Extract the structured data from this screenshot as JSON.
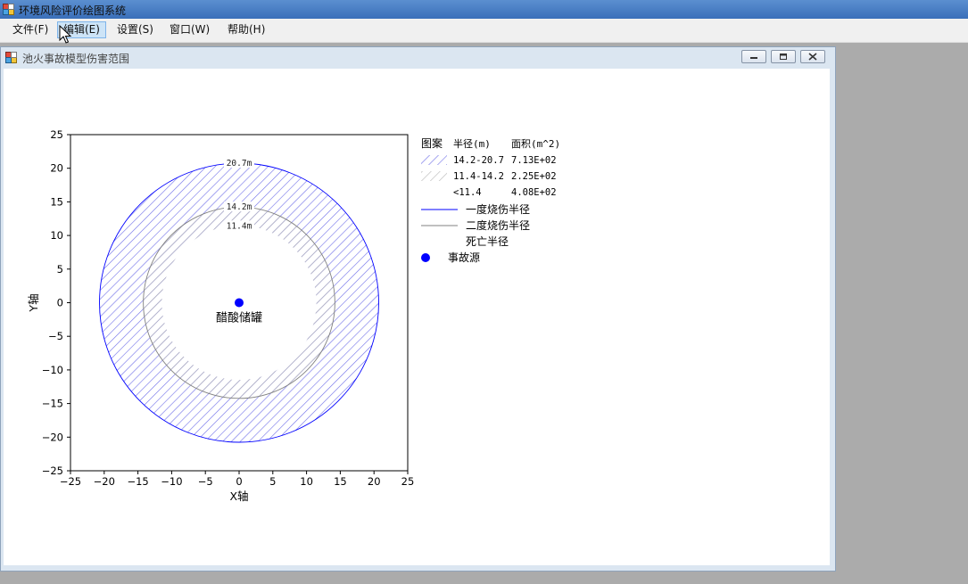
{
  "app": {
    "title": "环境风险评价绘图系统",
    "icon": "app-icon"
  },
  "menu": {
    "items": [
      {
        "label": "文件(F)"
      },
      {
        "label": "编辑(E)"
      },
      {
        "label": "设置(S)"
      },
      {
        "label": "窗口(W)"
      },
      {
        "label": "帮助(H)"
      }
    ],
    "active_index": 1
  },
  "child_window": {
    "title": "池火事故模型伤害范围",
    "icon": "child-window-icon",
    "buttons": [
      "minimize",
      "restore",
      "close"
    ]
  },
  "chart_data": {
    "type": "scatter",
    "subtype": "concentric-circle-damage-zones",
    "xlabel": "X轴",
    "ylabel": "Y轴",
    "xlim": [
      -25,
      25
    ],
    "ylim": [
      -25,
      25
    ],
    "xticks": [
      -25,
      -20,
      -15,
      -10,
      -5,
      0,
      5,
      10,
      15,
      20,
      25
    ],
    "yticks": [
      25,
      20,
      15,
      10,
      5,
      0,
      -5,
      -10,
      -15,
      -20,
      -25
    ],
    "grid": false,
    "legend_position": "right",
    "circles": [
      {
        "name": "一度烧伤半径",
        "radius": 20.7,
        "label": "20.7m",
        "stroke": "#0000ff",
        "hatch": "#6f6fe8"
      },
      {
        "name": "二度烧伤半径",
        "radius": 14.2,
        "label": "14.2m",
        "stroke": "#808080",
        "hatch": "#b4b4b4"
      },
      {
        "name": "死亡半径",
        "radius": 11.4,
        "label": "11.4m",
        "stroke": "#ffffff",
        "hatch": "none"
      }
    ],
    "source": {
      "name": "醋酸储罐",
      "x": 0,
      "y": 0,
      "color": "#0000ff"
    },
    "legend": {
      "headers": [
        "图案",
        "半径(m)",
        "面积(m^2)"
      ],
      "rows": [
        {
          "pattern": "blue-hatch",
          "radius": "14.2-20.7",
          "area": "7.13E+02"
        },
        {
          "pattern": "gray-hatch",
          "radius": "11.4-14.2",
          "area": "2.25E+02"
        },
        {
          "pattern": "none",
          "radius": "<11.4",
          "area": "4.08E+02"
        }
      ],
      "lines": [
        {
          "label": "一度烧伤半径",
          "color": "#0000ff"
        },
        {
          "label": "二度烧伤半径",
          "color": "#808080"
        },
        {
          "label": "死亡半径",
          "color": "#ffffff"
        }
      ],
      "source_label": "事故源"
    }
  }
}
